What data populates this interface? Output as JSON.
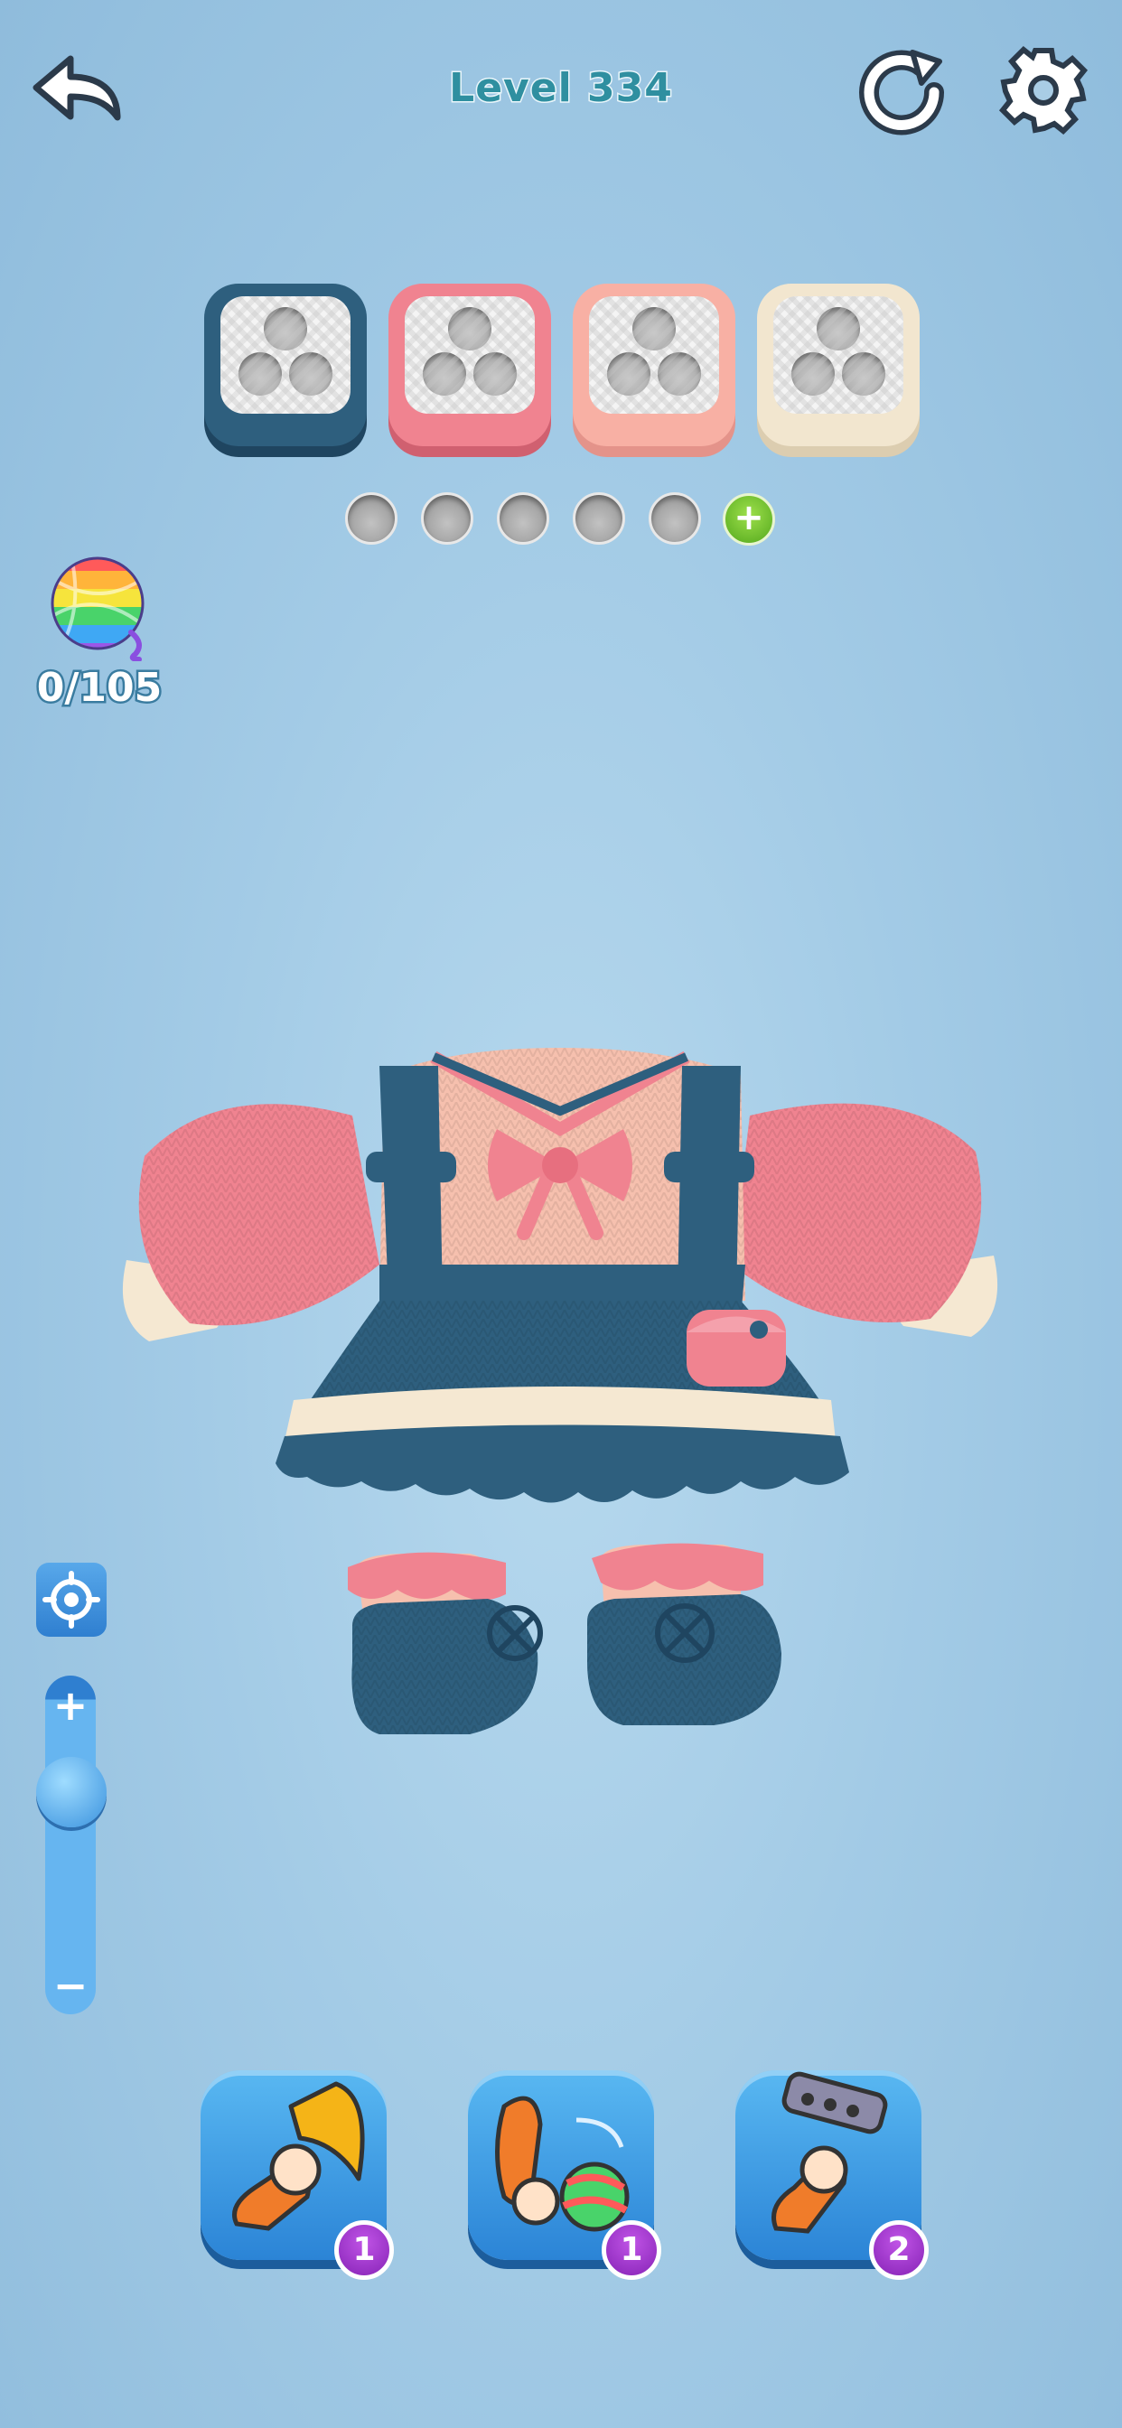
{
  "header": {
    "level_label": "Level 334",
    "back_icon": "undo-arrow-icon",
    "restart_icon": "restart-icon",
    "settings_icon": "gear-icon"
  },
  "spool_boxes": [
    {
      "color": "#2e5f7e",
      "holes": 3
    },
    {
      "color": "#f08390",
      "holes": 3
    },
    {
      "color": "#f8b0a4",
      "holes": 3
    },
    {
      "color": "#f2e6cf",
      "holes": 3
    }
  ],
  "slots": {
    "empty_count": 5,
    "add_icon": "plus-icon"
  },
  "yarn": {
    "count": "0/105",
    "icon": "yarn-ball-icon"
  },
  "zoom": {
    "plus": "+",
    "minus": "−",
    "level": 0.82,
    "focus_icon": "target-icon"
  },
  "boosters": [
    {
      "name": "hook",
      "count": "1",
      "icon": "crochet-hook-icon"
    },
    {
      "name": "shuffle",
      "count": "1",
      "icon": "yarn-throw-icon"
    },
    {
      "name": "comb",
      "count": "2",
      "icon": "lint-roller-icon"
    }
  ],
  "colors": {
    "navy": "#2e5f7e",
    "pink": "#f08390",
    "peach": "#f6c0ae",
    "cream": "#f5e8d2"
  }
}
